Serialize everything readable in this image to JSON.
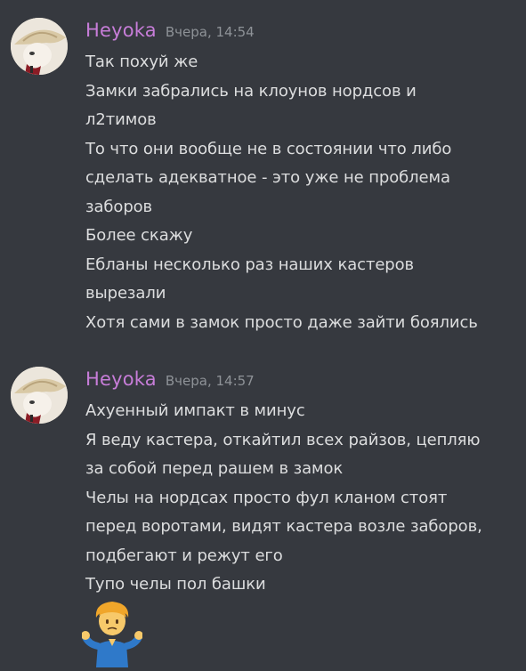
{
  "messages": [
    {
      "author": "Heyoka",
      "time": "Вчера, 14:54",
      "lines": [
        "Так похуй же",
        "Замки забрались на клоунов нордсов и",
        "л2тимов",
        "То что они вообще не в состоянии что либо",
        "сделать адекватное - это уже не проблема",
        "заборов",
        "Более скажу",
        "Ебланы несколько раз наших кастеров",
        "вырезали",
        "Хотя сами в замок просто даже зайти боялись"
      ]
    },
    {
      "author": "Heyoka",
      "time": "Вчера, 14:57",
      "lines": [
        "Ахуенный импакт в минус",
        "Я веду кастера, откайтил всех райзов, цепляю",
        "за собой перед рашем в замок",
        "Челы на нордсах просто фул кланом стоят",
        "перед воротами, видят кастера возле заборов,",
        "подбегают и режут его",
        "Тупо челы пол башки"
      ],
      "attachment_emoji": "person-shrugging-emoji"
    }
  ],
  "colors": {
    "background": "#36393f",
    "username": "#c77dd8",
    "timestamp": "#8e9297",
    "text": "#dcddde"
  }
}
